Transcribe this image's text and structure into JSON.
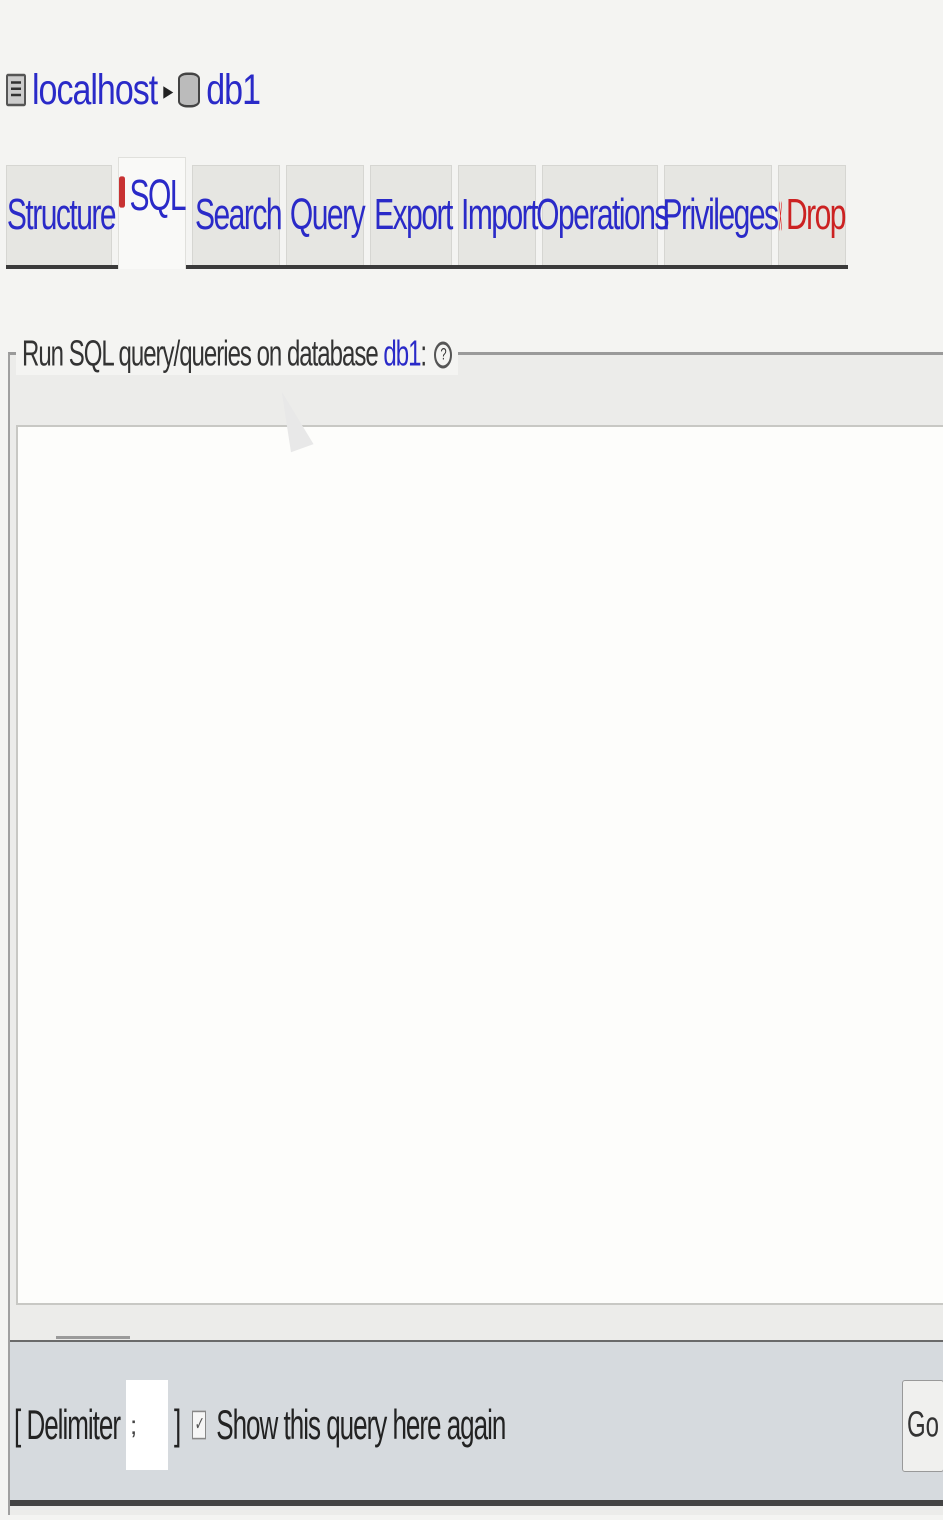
{
  "breadcrumb": {
    "server_label": "localhost",
    "server_icon": "server-icon",
    "database_label": "db1",
    "database_icon": "database-icon"
  },
  "tabs": [
    {
      "label": "Structure",
      "icon": "structure-icon",
      "active": false
    },
    {
      "label": "SQL",
      "icon": "sql-icon",
      "active": true
    },
    {
      "label": "Search",
      "icon": "search-icon",
      "active": false
    },
    {
      "label": "Query",
      "icon": "query-icon",
      "active": false
    },
    {
      "label": "Export",
      "icon": "export-icon",
      "active": false
    },
    {
      "label": "Import",
      "icon": "import-icon",
      "active": false
    },
    {
      "label": "Operations",
      "icon": "operations-icon",
      "active": false
    },
    {
      "label": "Privileges",
      "icon": "privileges-icon",
      "active": false
    },
    {
      "label": "Drop",
      "icon": "drop-icon",
      "active": false
    }
  ],
  "sql_panel": {
    "legend_prefix": "Run SQL query/queries on database",
    "database_link": "db1",
    "legend_suffix": ":",
    "help_icon": "help-icon",
    "query_text": ""
  },
  "footer": {
    "delimiter_open": "[ Delimiter",
    "delimiter_value": ";",
    "delimiter_close": "]",
    "show_query_checked": true,
    "show_query_label": "Show this query here again",
    "go_label": "Go"
  },
  "colors": {
    "link": "#2a2ac8",
    "drop": "#cc2222",
    "footer_bg": "#d6dade"
  }
}
